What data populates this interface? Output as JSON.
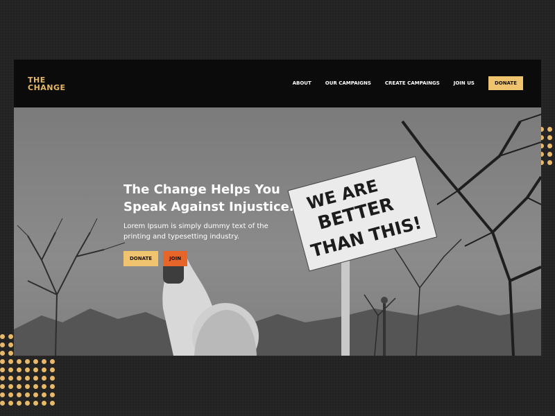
{
  "brand": {
    "logo_line1": "THE",
    "logo_line2": "CHANGE",
    "accent": "#f0c46e",
    "join_color": "#e8652a"
  },
  "nav": {
    "items": [
      "ABOUT",
      "OUR CAMPAIGNS",
      "CREATE CAMPAINGS",
      "JOIN US"
    ],
    "donate_label": "DONATE"
  },
  "hero": {
    "title_line1": "The Change Helps You",
    "title_line2": "Speak Against Injustice.",
    "subtitle_line1": "Lorem Ipsum is simply dummy text of the",
    "subtitle_line2": "printing and typesetting industry.",
    "donate_label": "DONATE",
    "join_label": "JOIN",
    "sign_line1": "WE ARE",
    "sign_line2": "BETTER",
    "sign_line3": "THAN THIS!"
  }
}
